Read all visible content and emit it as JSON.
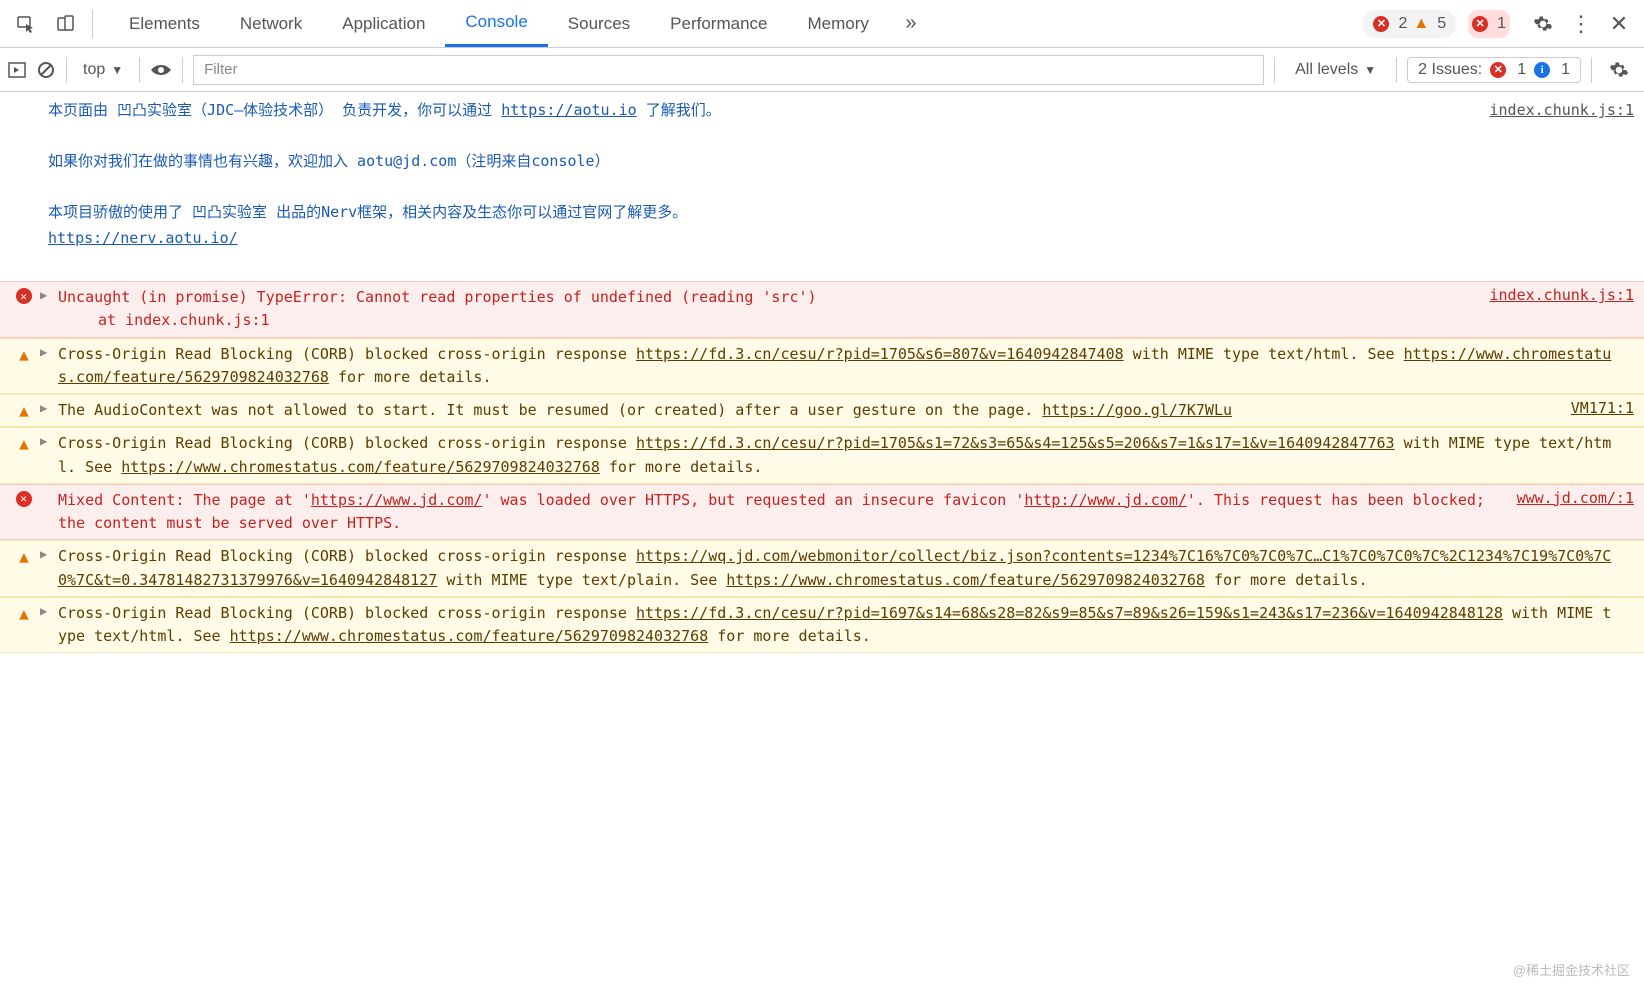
{
  "tabs": [
    "Elements",
    "Network",
    "Application",
    "Console",
    "Sources",
    "Performance",
    "Memory"
  ],
  "activeTab": "Console",
  "topbar": {
    "errors": "2",
    "warnings": "5",
    "extErrors": "1"
  },
  "toolbar": {
    "context": "top",
    "filterPlaceholder": "Filter",
    "levels": "All levels",
    "issuesLabel": "2 Issues:",
    "issuesErr": "1",
    "issuesInfo": "1"
  },
  "infoBlock": {
    "source": "index.chunk.js:1",
    "l1a": "本页面由 凹凸实验室（JDC–体验技术部） 负责开发，你可以通过 ",
    "l1link": "https://aotu.io",
    "l1b": " 了解我们。",
    "l2": "如果你对我们在做的事情也有兴趣，欢迎加入 aotu@jd.com（注明来自console）",
    "l3a": "本项目骄傲的使用了 凹凸实验室 出品的Nerv框架，相关内容及生态你可以通过官网了解更多。",
    "l3link": "https://nerv.aotu.io/"
  },
  "rows": [
    {
      "type": "error",
      "source": "index.chunk.js:1",
      "text": "Uncaught (in promise) TypeError: Cannot read properties of undefined (reading 'src')",
      "sub": "at ",
      "subLink": "index.chunk.js:1"
    },
    {
      "type": "warn",
      "source": "",
      "parts": [
        {
          "t": "Cross-Origin Read Blocking (CORB) blocked cross-origin response "
        },
        {
          "a": "https://fd.3.cn/cesu/r?pid=1705&s6=807&v=1640942847408"
        },
        {
          "t": " with MIME type text/html. See "
        },
        {
          "a": "https://www.chromestatus.com/feature/5629709824032768"
        },
        {
          "t": " for more details."
        }
      ]
    },
    {
      "type": "warn",
      "source": "VM171:1",
      "parts": [
        {
          "t": "The AudioContext was not allowed to start. It must be resumed (or created) after a user gesture on the page. "
        },
        {
          "a": "https://goo.gl/7K7WLu"
        }
      ]
    },
    {
      "type": "warn",
      "source": "",
      "parts": [
        {
          "t": "Cross-Origin Read Blocking (CORB) blocked cross-origin response "
        },
        {
          "a": "https://fd.3.cn/cesu/r?pid=1705&s1=72&s3=65&s4=125&s5=206&s7=1&s17=1&v=1640942847763"
        },
        {
          "t": " with MIME type text/html. See "
        },
        {
          "a": "https://www.chromestatus.com/feature/5629709824032768"
        },
        {
          "t": " for more details."
        }
      ]
    },
    {
      "type": "error2",
      "source": "www.jd.com/:1",
      "parts": [
        {
          "t": "Mixed Content: The page at '"
        },
        {
          "a": "https://www.jd.com/"
        },
        {
          "t": "' was loaded over HTTPS, but requested an insecure favicon '"
        },
        {
          "a": "http://www.jd.com/"
        },
        {
          "t": "'. This request has been blocked; the content must be served over HTTPS."
        }
      ]
    },
    {
      "type": "warn",
      "source": "",
      "parts": [
        {
          "t": "Cross-Origin Read Blocking (CORB) blocked cross-origin response "
        },
        {
          "a": "https://wq.jd.com/webmonitor/collect/biz.json?contents=1234%7C16%7C0%7C0%7C…C1%7C0%7C0%7C%2C1234%7C19%7C0%7C0%7C&t=0.34781482731379976&v=1640942848127"
        },
        {
          "t": " with MIME type text/plain. See "
        },
        {
          "a": "https://www.chromestatus.com/feature/5629709824032768"
        },
        {
          "t": " for more details."
        }
      ]
    },
    {
      "type": "warn",
      "source": "",
      "parts": [
        {
          "t": "Cross-Origin Read Blocking (CORB) blocked cross-origin response "
        },
        {
          "a": "https://fd.3.cn/cesu/r?pid=1697&s14=68&s28=82&s9=85&s7=89&s26=159&s1=243&s17=236&v=1640942848128"
        },
        {
          "t": " with MIME type text/html. See "
        },
        {
          "a": "https://www.chromestatus.com/feature/5629709824032768"
        },
        {
          "t": " for more details."
        }
      ]
    }
  ],
  "watermark": "@稀土掘金技术社区"
}
